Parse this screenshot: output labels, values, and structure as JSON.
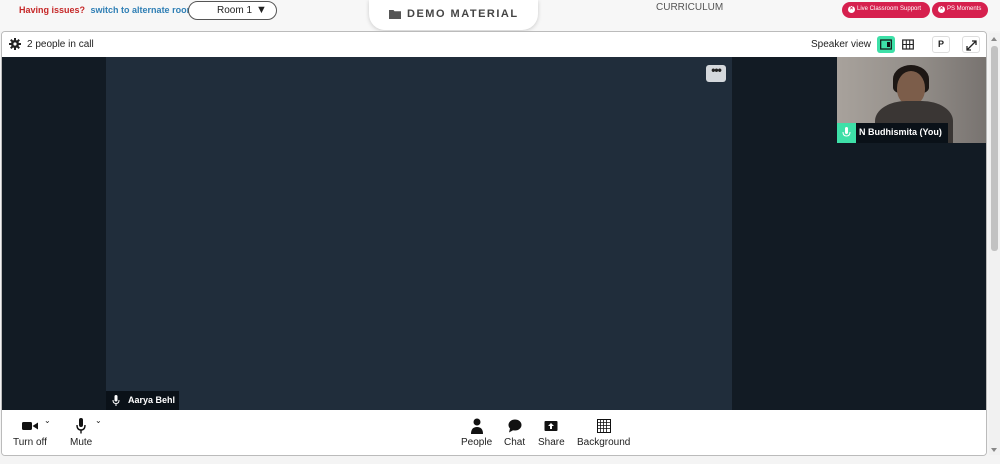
{
  "topbar": {
    "issues_text": "Having issues?",
    "switch_text": "switch to alternate room",
    "room_select_value": "Room 1",
    "demo_material": "DEMO MATERIAL",
    "curriculum": "CURRICULUM",
    "live_support_label": "Live Classroom Support",
    "ps_moments_label": "PS Moments"
  },
  "call": {
    "people_count": "2 people in call",
    "view_label": "Speaker view",
    "p_button": "P",
    "main_participant": "Aarya Behl",
    "self_participant": "N Budhismita (You)",
    "more_label": "•••"
  },
  "toolbar": {
    "turn_off": "Turn off",
    "mute": "Mute",
    "people": "People",
    "chat": "Chat",
    "share": "Share",
    "background": "Background"
  },
  "colors": {
    "accent": "#3ee0a8",
    "brand_red": "#d6204e",
    "stage_bg": "#121b24",
    "main_tile_bg": "#202d3b"
  }
}
